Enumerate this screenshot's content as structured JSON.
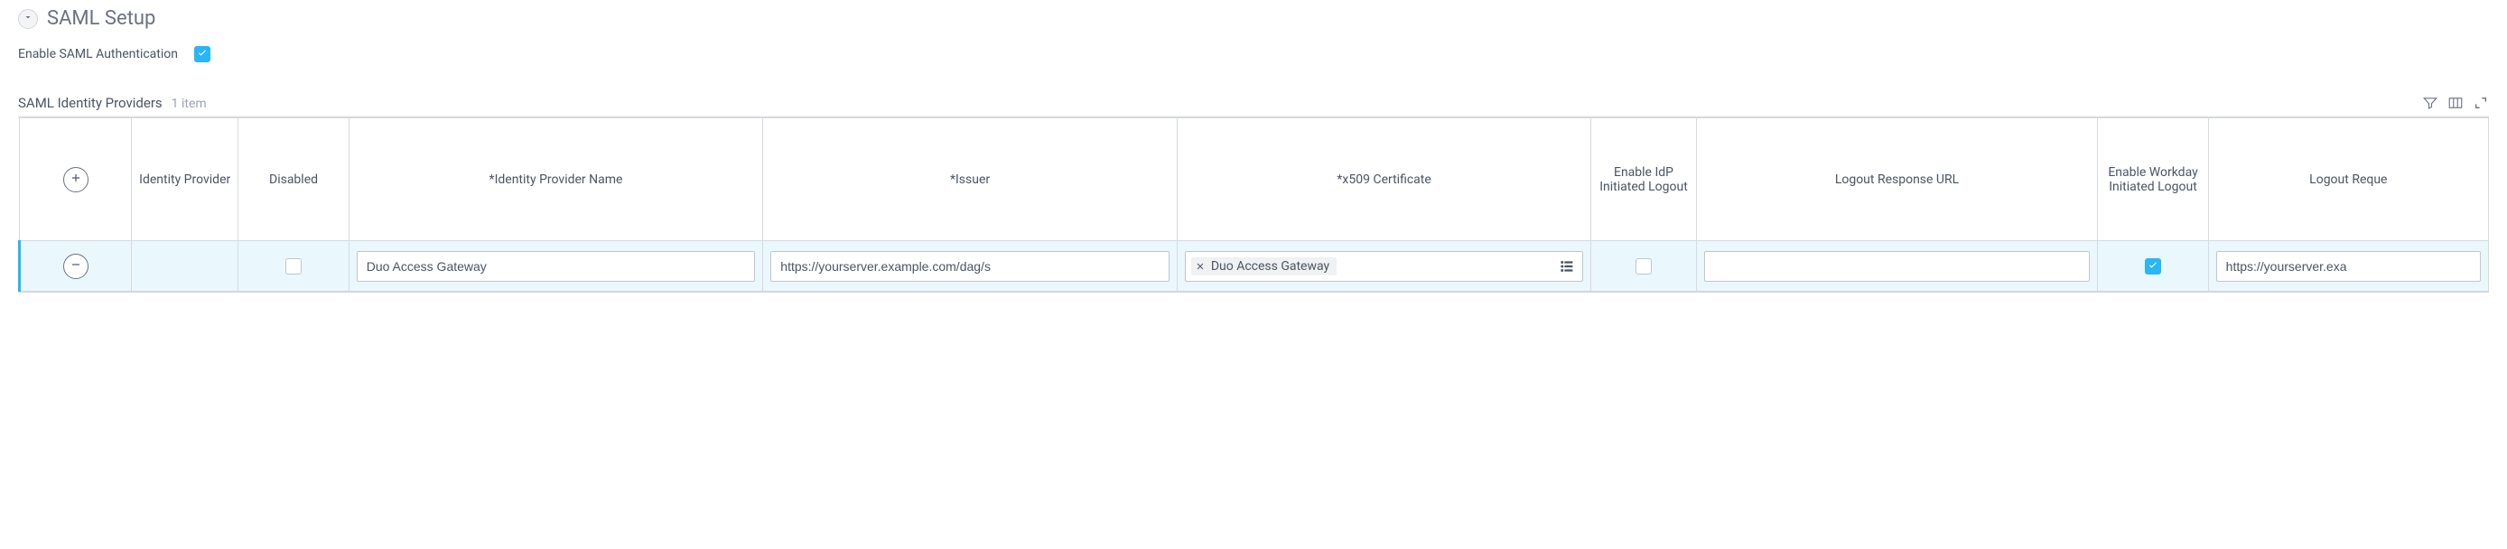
{
  "section": {
    "title": "SAML Setup"
  },
  "enable": {
    "label": "Enable SAML Authentication",
    "checked": true
  },
  "table": {
    "title": "SAML Identity Providers",
    "count": "1 item",
    "cols": {
      "ip": "Identity Provider",
      "disabled": "Disabled",
      "name": "*Identity Provider Name",
      "issuer": "*Issuer",
      "cert": "*x509 Certificate",
      "eidp": "Enable IdP Initiated Logout",
      "logoutresp": "Logout Response URL",
      "ewd": "Enable Workday Initiated Logout",
      "logoutreq": "Logout Reque"
    }
  },
  "row": {
    "disabled": false,
    "name": "Duo Access Gateway",
    "issuer": "https://yourserver.example.com/dag/s",
    "cert": "Duo Access Gateway",
    "eidp": false,
    "logoutresp": "",
    "ewd": true,
    "logoutreq": "https://yourserver.exa"
  }
}
